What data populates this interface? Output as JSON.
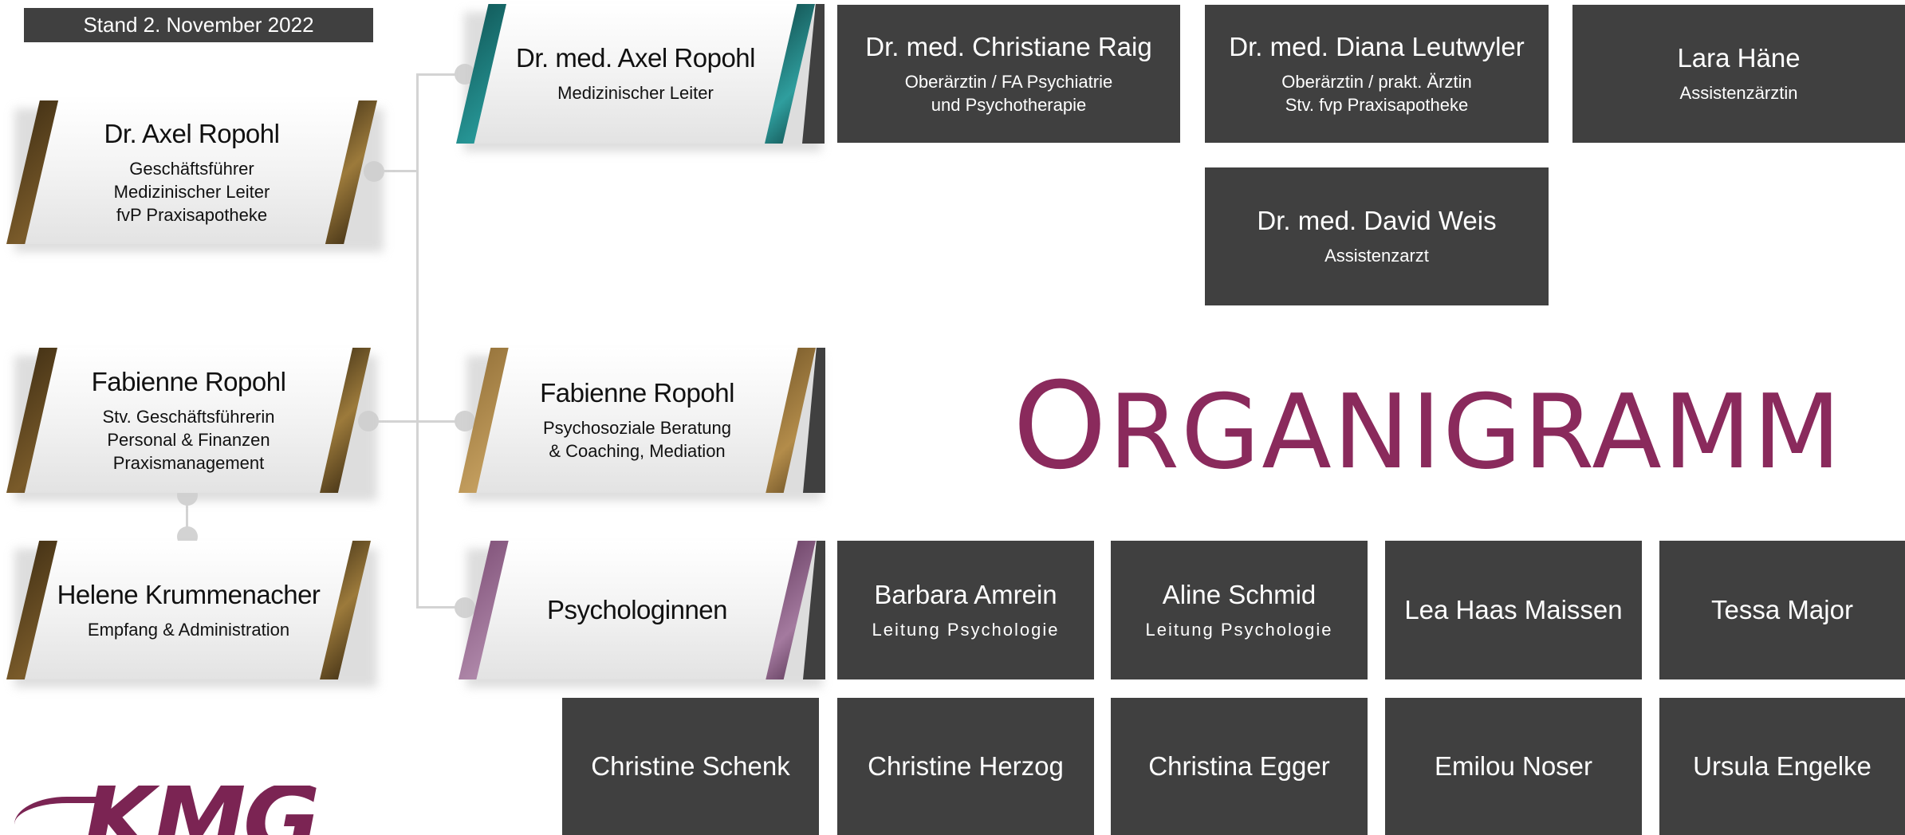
{
  "stand": "Stand 2. November 2022",
  "title": {
    "first": "O",
    "rest": "RGANIGRAMM"
  },
  "logo": "KMG",
  "left_cards": [
    {
      "name": "Dr. Axel Ropohl",
      "role": "Geschäftsführer\nMedizinischer Leiter\nfvP Praxisapotheke"
    },
    {
      "name": "Fabienne Ropohl",
      "role": "Stv. Geschäftsführerin\nPersonal & Finanzen\nPraxismanagement"
    },
    {
      "name": "Helene Krummenacher",
      "role": "Empfang & Administration"
    }
  ],
  "mid_cards": [
    {
      "name": "Dr. med. Axel Ropohl",
      "role": "Medizinischer Leiter"
    },
    {
      "name": "Fabienne Ropohl",
      "role": "Psychosoziale Beratung\n& Coaching, Mediation"
    },
    {
      "name": "Psychologinnen",
      "role": ""
    }
  ],
  "doctors": [
    {
      "name": "Dr. med. Christiane Raig",
      "role": "Oberärztin / FA Psychiatrie\nund Psychotherapie"
    },
    {
      "name": "Dr. med. Diana Leutwyler",
      "role": "Oberärztin / prakt. Ärztin\nStv. fvp Praxisapotheke"
    },
    {
      "name": "Lara Häne",
      "role": "Assistenzärztin"
    },
    {
      "name": "Dr. med. David Weis",
      "role": "Assistenzarzt"
    }
  ],
  "psychologists_row1": [
    {
      "name": "Barbara Amrein",
      "role": "Leitung Psychologie"
    },
    {
      "name": "Aline Schmid",
      "role": "Leitung Psychologie"
    },
    {
      "name": "Lea Haas Maissen",
      "role": ""
    },
    {
      "name": "Tessa Major",
      "role": ""
    }
  ],
  "psychologists_row2": [
    {
      "name": "Christine Schenk"
    },
    {
      "name": "Christine Herzog"
    },
    {
      "name": "Christina Egger"
    },
    {
      "name": "Emilou Noser"
    },
    {
      "name": "Ursula Engelke"
    }
  ],
  "colors": {
    "dark_box": "#404040",
    "title": "#8a2a5c",
    "connector": "#d3d3d3"
  }
}
